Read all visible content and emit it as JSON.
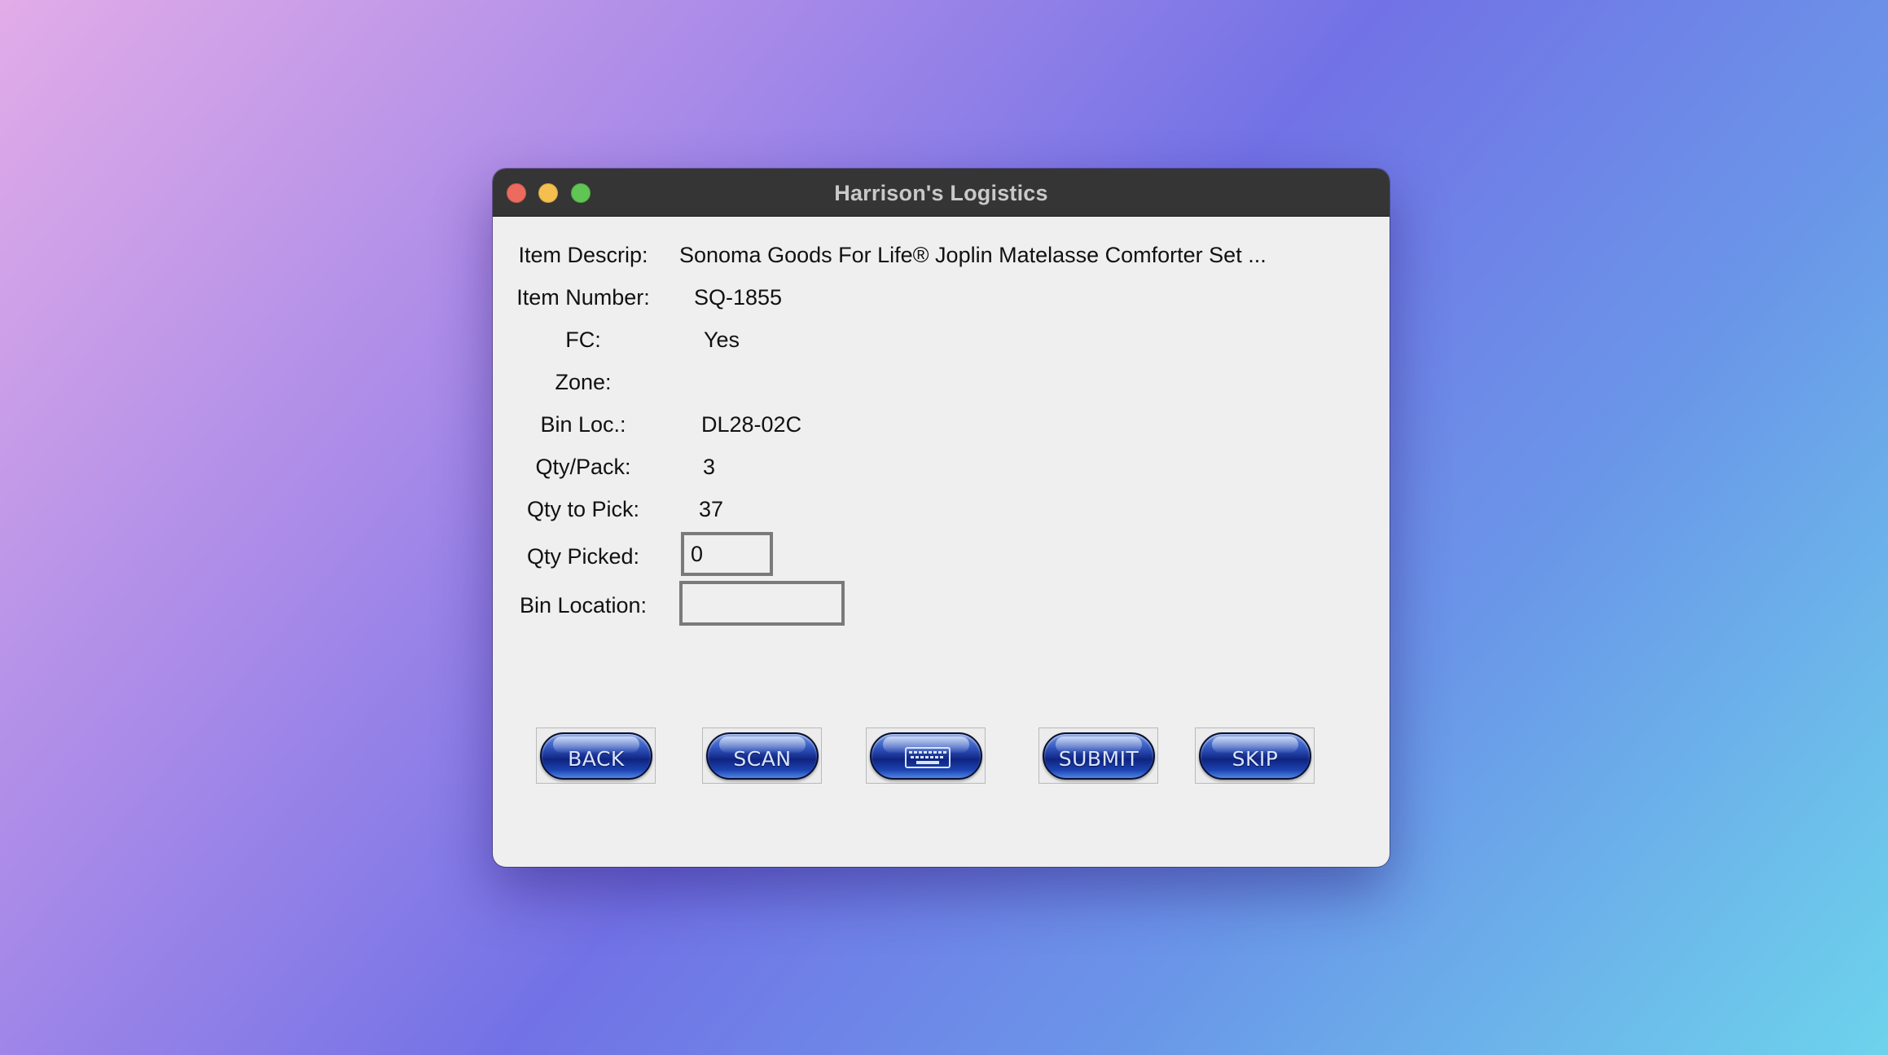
{
  "window": {
    "title": "Harrison's Logistics"
  },
  "fields": {
    "item_descrip": {
      "label": "Item Descrip:",
      "value": "Sonoma Goods For Life® Joplin Matelasse Comforter Set ..."
    },
    "item_number": {
      "label": "Item Number:",
      "value": "SQ-1855"
    },
    "fc": {
      "label": "FC:",
      "value": "Yes"
    },
    "zone": {
      "label": "Zone:",
      "value": ""
    },
    "bin_loc": {
      "label": "Bin Loc.:",
      "value": "DL28-02C"
    },
    "qty_pack": {
      "label": "Qty/Pack:",
      "value": "3"
    },
    "qty_to_pick": {
      "label": "Qty to Pick:",
      "value": "37"
    },
    "qty_picked": {
      "label": "Qty Picked:",
      "value": "0"
    },
    "bin_location": {
      "label": "Bin Location:",
      "value": ""
    }
  },
  "buttons": {
    "back": "BACK",
    "scan": "SCAN",
    "keyboard": "keyboard-icon",
    "submit": "SUBMIT",
    "skip": "SKIP"
  },
  "colors": {
    "titlebar": "#353535",
    "window_bg": "#efefef",
    "button_blue": "#1c43b2",
    "close": "#ed6a5e",
    "minimize": "#f5bf4f",
    "maximize": "#61c554"
  }
}
